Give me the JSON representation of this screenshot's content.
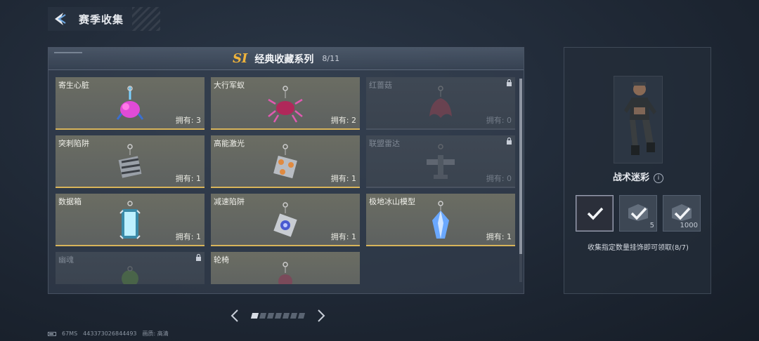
{
  "header": {
    "title": "赛季收集"
  },
  "collection": {
    "badge": "SI",
    "title": "经典收藏系列",
    "progress": "8/11",
    "items": [
      {
        "name": "寄生心脏",
        "owned": "拥有: 3",
        "locked": false,
        "icon": "parasite-heart-charm"
      },
      {
        "name": "大行军蚁",
        "owned": "拥有: 2",
        "locked": false,
        "icon": "army-ant-charm"
      },
      {
        "name": "红蔷菇",
        "owned": "拥有: 0",
        "locked": true,
        "icon": "red-mushroom-charm"
      },
      {
        "name": "突刺陷阱",
        "owned": "拥有: 1",
        "locked": false,
        "icon": "spike-trap-charm"
      },
      {
        "name": "高能激光",
        "owned": "拥有: 1",
        "locked": false,
        "icon": "laser-charm"
      },
      {
        "name": "联盟雷达",
        "owned": "拥有: 0",
        "locked": true,
        "icon": "radar-charm"
      },
      {
        "name": "数据箱",
        "owned": "拥有: 1",
        "locked": false,
        "icon": "data-box-charm"
      },
      {
        "name": "减速陷阱",
        "owned": "拥有: 1",
        "locked": false,
        "icon": "slow-trap-charm"
      },
      {
        "name": "极地冰山模型",
        "owned": "拥有: 1",
        "locked": false,
        "icon": "iceberg-charm"
      },
      {
        "name": "幽魂",
        "owned": "",
        "locked": true,
        "icon": "ghost-charm"
      },
      {
        "name": "轮椅",
        "owned": "",
        "locked": false,
        "icon": "wheelchair-charm"
      }
    ]
  },
  "pager": {
    "pages": 7,
    "current": 1
  },
  "reward": {
    "name": "战术迷彩",
    "info_symbol": "i",
    "tiers": [
      {
        "count": "",
        "done": true
      },
      {
        "count": "5",
        "done": false
      },
      {
        "count": "1000",
        "done": false
      }
    ],
    "description": "收集指定数量挂饰即可领取(8/7)"
  },
  "status": {
    "ping": "67MS",
    "uid": "443373026844493",
    "quality": "画质: 高清"
  },
  "colors": {
    "accent_gold": "#d8b45a",
    "badge_gold": "#f0b43c"
  }
}
